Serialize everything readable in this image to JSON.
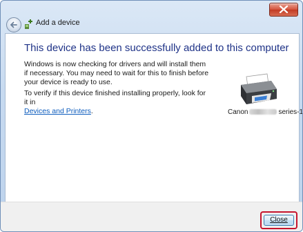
{
  "window": {
    "title": "Add a device",
    "close_icon": "close-icon"
  },
  "content": {
    "heading": "This device has been successfully added to this computer",
    "paragraph1": "Windows is now checking for drivers and will install them if necessary. You may need to wait for this to finish before your device is ready to use.",
    "paragraph2_prefix": "To verify if this device finished installing properly, look for it in",
    "paragraph2_link": "Devices and Printers",
    "paragraph2_suffix": ".",
    "device": {
      "name_prefix": "Canon",
      "name_suffix": "series-1",
      "icon": "printer-icon"
    }
  },
  "footer": {
    "close_label": "Close"
  }
}
